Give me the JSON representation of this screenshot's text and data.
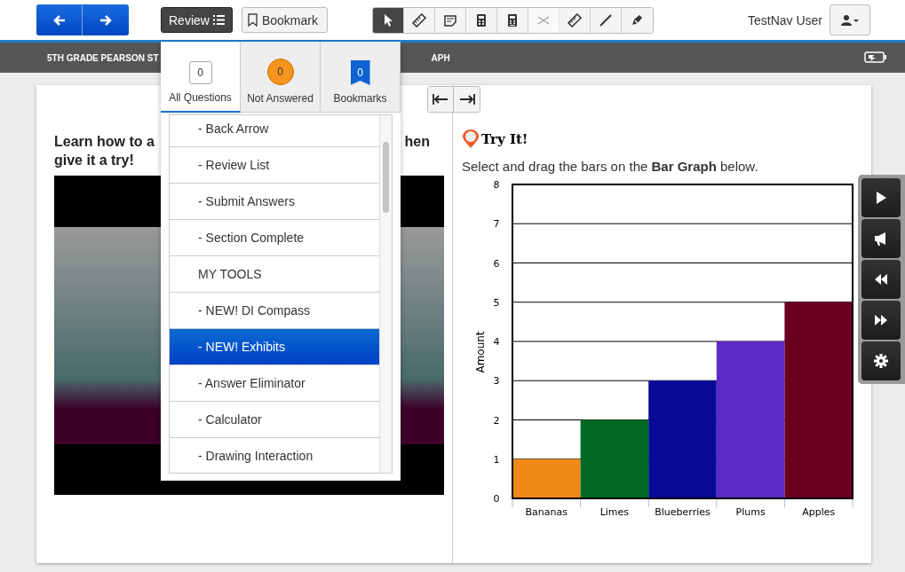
{
  "toolbar": {
    "review_label": "Review",
    "bookmark_label": "Bookmark",
    "tools": [
      {
        "selected": true,
        "disabled": false
      },
      {
        "selected": false,
        "disabled": false
      },
      {
        "selected": false,
        "disabled": false
      },
      {
        "selected": false,
        "disabled": false
      },
      {
        "selected": false,
        "disabled": false
      },
      {
        "selected": false,
        "disabled": true
      },
      {
        "selected": false,
        "disabled": false
      },
      {
        "selected": false,
        "disabled": false
      },
      {
        "selected": false,
        "disabled": false
      }
    ],
    "user_name": "TestNav User"
  },
  "banner": {
    "title_start": "5TH GRADE PEARSON ST",
    "title_end": "APH"
  },
  "review_panel": {
    "tabs": [
      {
        "kind": "box",
        "count": "0",
        "label": "All Questions",
        "selected": true
      },
      {
        "kind": "circle",
        "count": "0",
        "label": "Not Answered",
        "selected": false
      },
      {
        "kind": "flag",
        "count": "0",
        "label": "Bookmarks",
        "selected": false
      }
    ],
    "items": [
      {
        "label": "- Back Arrow",
        "selected": false
      },
      {
        "label": "- Review List",
        "selected": false
      },
      {
        "label": "- Submit Answers",
        "selected": false
      },
      {
        "label": "- Section Complete",
        "selected": false
      },
      {
        "label": "MY TOOLS",
        "selected": false
      },
      {
        "label": "- NEW! DI Compass",
        "selected": false
      },
      {
        "label": "- NEW! Exhibits",
        "selected": true
      },
      {
        "label": "- Answer Eliminator",
        "selected": false
      },
      {
        "label": "- Calculator",
        "selected": false
      },
      {
        "label": "- Drawing Interaction",
        "selected": false
      }
    ]
  },
  "left_pane": {
    "heading_start": "Learn how to a",
    "heading_end": "hen",
    "heading_line2": "give it a try!"
  },
  "right_pane": {
    "title": "Try It!",
    "instruction": "Select and drag the bars on the **Bar Graph** below.",
    "chart_data": {
      "type": "bar",
      "ylabel": "Amount",
      "categories": [
        "Bananas",
        "Limes",
        "Blueberries",
        "Plums",
        "Apples"
      ],
      "values": [
        1,
        2,
        3,
        4,
        5
      ],
      "grid": true,
      "colors": [
        "#ef8a17",
        "#026a22",
        "#060a96",
        "#5e2ac6",
        "#6a0020"
      ],
      "ylim": [
        0,
        8
      ],
      "yticks": [
        0,
        1,
        2,
        3,
        4,
        5,
        6,
        7,
        8
      ]
    }
  }
}
